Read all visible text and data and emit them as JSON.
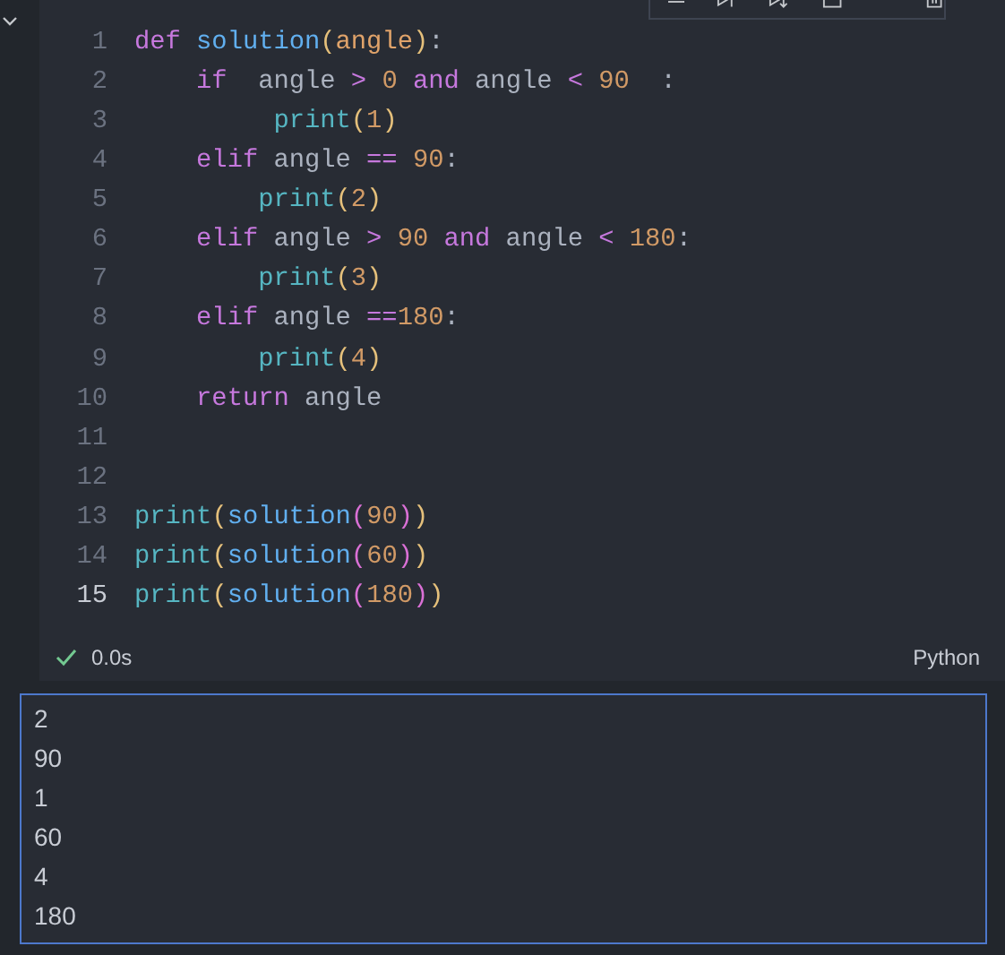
{
  "code_lines": [
    {
      "number": "1",
      "tokens": [
        {
          "kind": "keyword",
          "text": "def "
        },
        {
          "kind": "function",
          "text": "solution"
        },
        {
          "kind": "bracket",
          "text": "("
        },
        {
          "kind": "param",
          "text": "angle"
        },
        {
          "kind": "bracket",
          "text": ")"
        },
        {
          "kind": "text",
          "text": ":"
        }
      ]
    },
    {
      "number": "2",
      "tokens": [
        {
          "kind": "keyword",
          "text": "    if"
        },
        {
          "kind": "text",
          "text": "  angle "
        },
        {
          "kind": "operator",
          "text": "> "
        },
        {
          "kind": "number",
          "text": "0 "
        },
        {
          "kind": "keyword",
          "text": "and"
        },
        {
          "kind": "text",
          "text": " angle "
        },
        {
          "kind": "operator",
          "text": "< "
        },
        {
          "kind": "number",
          "text": "90"
        },
        {
          "kind": "text",
          "text": "  :"
        }
      ]
    },
    {
      "number": "3",
      "tokens": [
        {
          "kind": "builtin",
          "text": "         print"
        },
        {
          "kind": "bracket",
          "text": "("
        },
        {
          "kind": "number",
          "text": "1"
        },
        {
          "kind": "bracket",
          "text": ")"
        }
      ]
    },
    {
      "number": "4",
      "tokens": [
        {
          "kind": "keyword",
          "text": "    elif"
        },
        {
          "kind": "text",
          "text": " angle "
        },
        {
          "kind": "operator",
          "text": "== "
        },
        {
          "kind": "number",
          "text": "90"
        },
        {
          "kind": "text",
          "text": ":"
        }
      ]
    },
    {
      "number": "5",
      "tokens": [
        {
          "kind": "builtin",
          "text": "        print"
        },
        {
          "kind": "bracket",
          "text": "("
        },
        {
          "kind": "number",
          "text": "2"
        },
        {
          "kind": "bracket",
          "text": ")"
        }
      ]
    },
    {
      "number": "6",
      "tokens": [
        {
          "kind": "keyword",
          "text": "    elif"
        },
        {
          "kind": "text",
          "text": " angle "
        },
        {
          "kind": "operator",
          "text": "> "
        },
        {
          "kind": "number",
          "text": "90 "
        },
        {
          "kind": "keyword",
          "text": "and"
        },
        {
          "kind": "text",
          "text": " angle "
        },
        {
          "kind": "operator",
          "text": "< "
        },
        {
          "kind": "number",
          "text": "180"
        },
        {
          "kind": "text",
          "text": ":"
        }
      ]
    },
    {
      "number": "7",
      "tokens": [
        {
          "kind": "builtin",
          "text": "        print"
        },
        {
          "kind": "bracket",
          "text": "("
        },
        {
          "kind": "number",
          "text": "3"
        },
        {
          "kind": "bracket",
          "text": ")"
        }
      ]
    },
    {
      "number": "8",
      "tokens": [
        {
          "kind": "keyword",
          "text": "    elif"
        },
        {
          "kind": "text",
          "text": " angle "
        },
        {
          "kind": "operator",
          "text": "=="
        },
        {
          "kind": "number",
          "text": "180"
        },
        {
          "kind": "text",
          "text": ":"
        }
      ]
    },
    {
      "number": "9",
      "tokens": [
        {
          "kind": "builtin",
          "text": "        print"
        },
        {
          "kind": "bracket",
          "text": "("
        },
        {
          "kind": "number",
          "text": "4"
        },
        {
          "kind": "bracket",
          "text": ")"
        }
      ]
    },
    {
      "number": "10",
      "tokens": [
        {
          "kind": "keyword",
          "text": "    return"
        },
        {
          "kind": "text",
          "text": " angle"
        }
      ]
    },
    {
      "number": "11"
    },
    {
      "number": "12"
    },
    {
      "number": "13",
      "tokens": [
        {
          "kind": "builtin",
          "text": "print"
        },
        {
          "kind": "bracket",
          "text": "("
        },
        {
          "kind": "function",
          "text": "solution"
        },
        {
          "kind": "bracket2",
          "text": "("
        },
        {
          "kind": "number",
          "text": "90"
        },
        {
          "kind": "bracket2",
          "text": ")"
        },
        {
          "kind": "bracket",
          "text": ")"
        }
      ]
    },
    {
      "number": "14",
      "tokens": [
        {
          "kind": "builtin",
          "text": "print"
        },
        {
          "kind": "bracket",
          "text": "("
        },
        {
          "kind": "function",
          "text": "solution"
        },
        {
          "kind": "bracket2",
          "text": "("
        },
        {
          "kind": "number",
          "text": "60"
        },
        {
          "kind": "bracket2",
          "text": ")"
        },
        {
          "kind": "bracket",
          "text": ")"
        }
      ]
    },
    {
      "number": "15",
      "tokens": [
        {
          "kind": "builtin",
          "text": "print"
        },
        {
          "kind": "bracket",
          "text": "("
        },
        {
          "kind": "function",
          "text": "solution"
        },
        {
          "kind": "bracket2",
          "text": "("
        },
        {
          "kind": "number",
          "text": "180"
        },
        {
          "kind": "bracket2",
          "text": ")"
        },
        {
          "kind": "bracket",
          "text": ")"
        }
      ]
    }
  ],
  "status": {
    "succeeded": true,
    "duration": "0.0s",
    "language": "Python"
  },
  "output": [
    "2",
    "90",
    "1",
    "60",
    "4",
    "180"
  ]
}
